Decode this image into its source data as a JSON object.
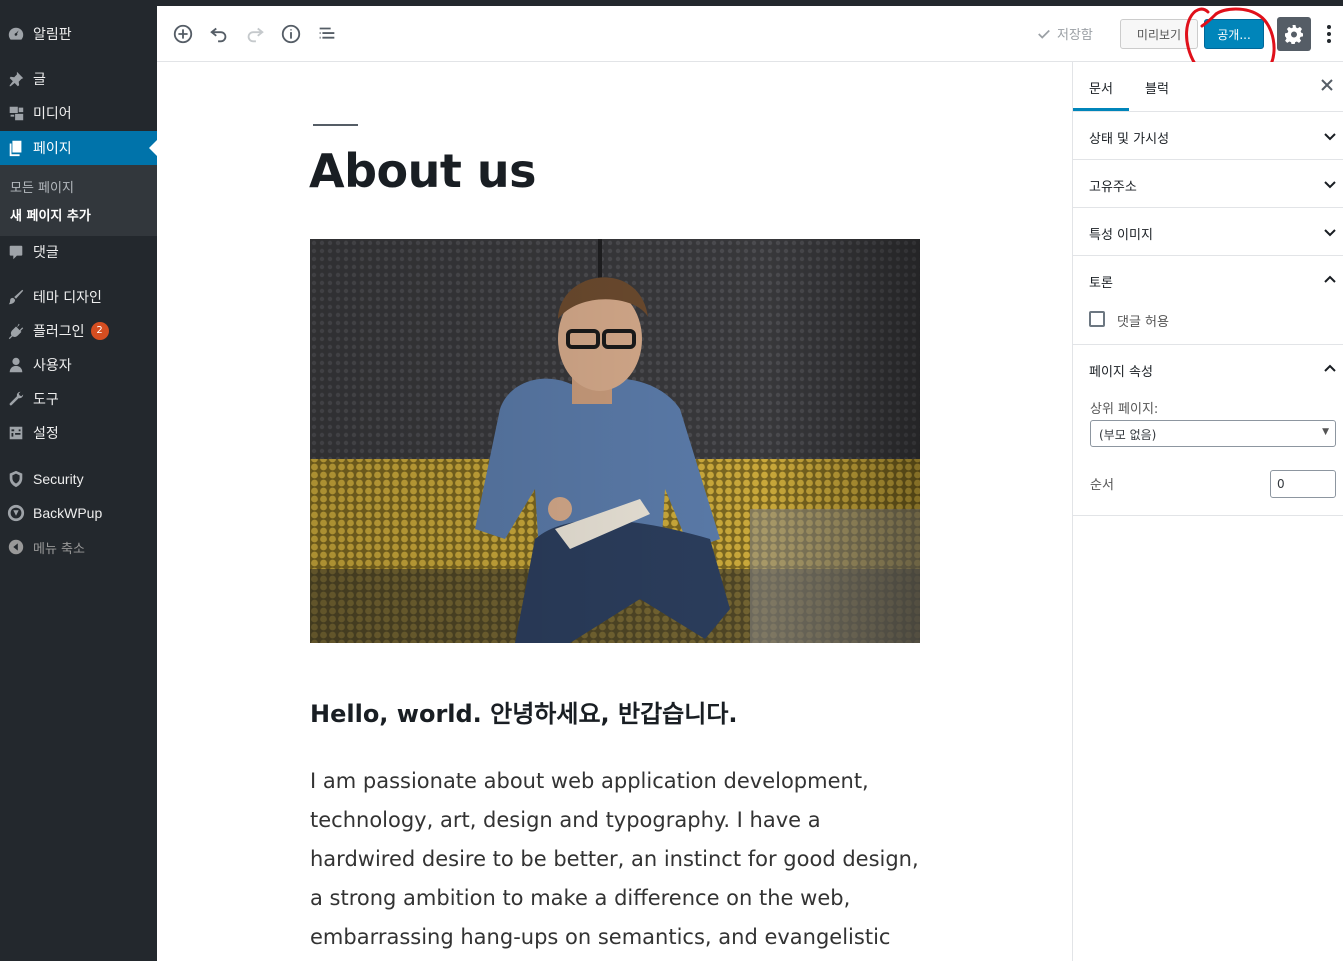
{
  "admin_menu": {
    "dashboard": "알림판",
    "posts": "글",
    "media": "미디어",
    "pages": "페이지",
    "pages_sub_all": "모든 페이지",
    "pages_sub_add": "새 페이지 추가",
    "comments": "댓글",
    "appearance": "테마 디자인",
    "plugins": "플러그인",
    "plugins_badge": "2",
    "users": "사용자",
    "tools": "도구",
    "settings": "설정",
    "security": "Security",
    "backwpup": "BackWPup",
    "collapse": "메뉴 축소"
  },
  "toolbar": {
    "saved_label": "저장함",
    "preview_label": "미리보기",
    "publish_label": "공개..."
  },
  "editor": {
    "title": "About us",
    "heading": "Hello, world. 안녕하세요, 반갑습니다.",
    "paragraph": "I am passionate about web application development, technology, art, design and typography. I have a hardwired desire to be better, an instinct for good design, a strong ambition to make a difference on the web, embarrassing hang-ups on semantics, and evangelistic tendencies."
  },
  "inspector": {
    "tab_document": "문서",
    "tab_block": "블럭",
    "panel_status": "상태 및 가시성",
    "panel_permalink": "고유주소",
    "panel_featured": "특성 이미지",
    "panel_discussion": "토론",
    "allow_comments": "댓글 허용",
    "panel_attributes": "페이지 속성",
    "parent_label": "상위 페이지:",
    "parent_value": "(부모 없음)",
    "order_label": "순서",
    "order_value": "0"
  },
  "colors": {
    "sidebar_bg": "#23282d",
    "current_menu": "#0073aa",
    "publish_button": "#0085ba",
    "annotation_red": "#e0101a"
  }
}
